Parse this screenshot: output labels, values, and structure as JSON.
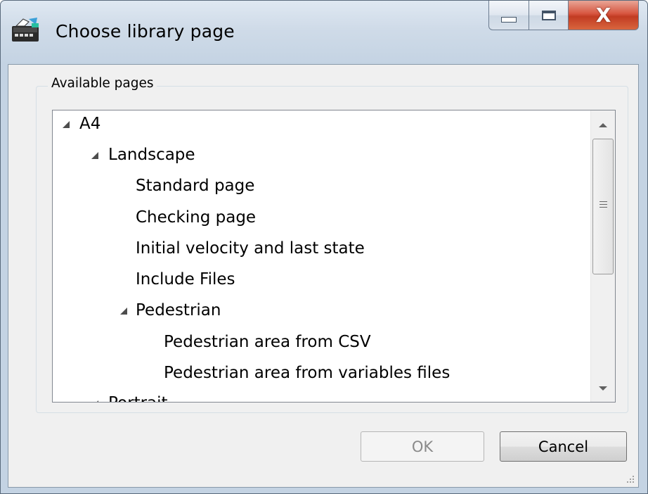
{
  "window": {
    "title": "Choose library page",
    "app_icon": "library-app-icon",
    "caption_buttons": {
      "minimize": "minimize-icon",
      "maximize": "maximize-icon",
      "close": "X"
    }
  },
  "group": {
    "label": "Available pages"
  },
  "tree": {
    "nodes": [
      {
        "label": "A4",
        "expanded": true
      },
      {
        "label": "Landscape",
        "expanded": true
      },
      {
        "label": "Standard page"
      },
      {
        "label": "Checking page"
      },
      {
        "label": "Initial velocity and last state"
      },
      {
        "label": "Include Files"
      },
      {
        "label": "Pedestrian",
        "expanded": true
      },
      {
        "label": "Pedestrian area from CSV"
      },
      {
        "label": "Pedestrian area from variables files"
      },
      {
        "label": "Portrait",
        "expanded": true,
        "partially_visible": true
      }
    ],
    "scrollbar": {
      "position": 0
    }
  },
  "buttons": {
    "ok": "OK",
    "cancel": "Cancel",
    "ok_enabled": false
  },
  "colors": {
    "close_button": "#c23b22",
    "frame": "#c4d3e3",
    "client": "#f0f0f0"
  }
}
